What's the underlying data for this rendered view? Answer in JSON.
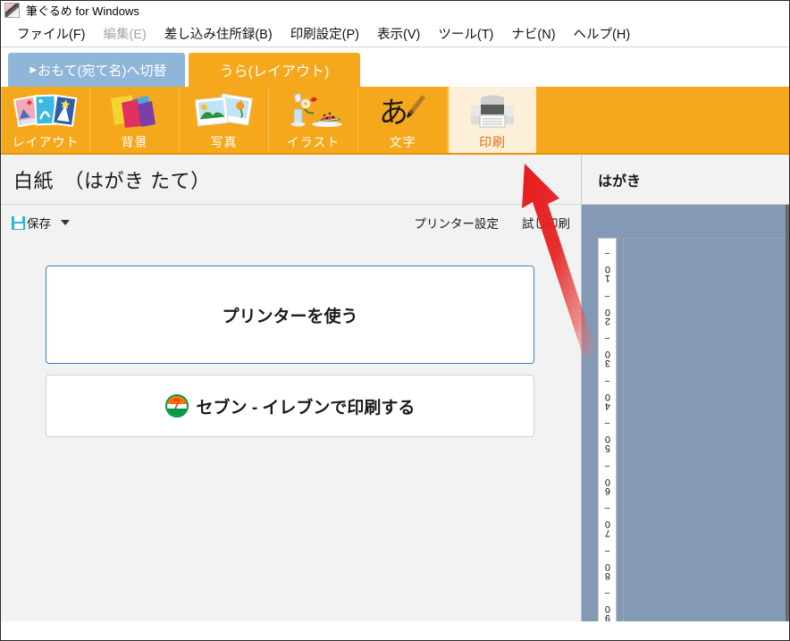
{
  "window": {
    "title": "筆ぐるめ for Windows",
    "app_icon": "brush-icon"
  },
  "menubar": {
    "items": [
      {
        "label": "ファイル(F)",
        "disabled": false
      },
      {
        "label": "編集(E)",
        "disabled": true
      },
      {
        "label": "差し込み住所録(B)",
        "disabled": false
      },
      {
        "label": "印刷設定(P)",
        "disabled": false
      },
      {
        "label": "表示(V)",
        "disabled": false
      },
      {
        "label": "ツール(T)",
        "disabled": false
      },
      {
        "label": "ナビ(N)",
        "disabled": false
      },
      {
        "label": "ヘルプ(H)",
        "disabled": false
      }
    ]
  },
  "face_tabs": {
    "omote_label": "おもて(宛て名)へ切替",
    "omote_arrow": "▶",
    "ura_label": "うら(レイアウト)",
    "selected": "ura"
  },
  "icon_toolbar": {
    "items": [
      {
        "label": "レイアウト",
        "icon": "layout-cards-icon",
        "selected": false
      },
      {
        "label": "背景",
        "icon": "background-shapes-icon",
        "selected": false
      },
      {
        "label": "写真",
        "icon": "photos-icon",
        "selected": false
      },
      {
        "label": "イラスト",
        "icon": "illustration-watermelon-icon",
        "selected": false
      },
      {
        "label": "文字",
        "icon": "text-brush-icon",
        "selected": false
      },
      {
        "label": "印刷",
        "icon": "printer-icon",
        "selected": true
      }
    ]
  },
  "document": {
    "title": "白紙　（はがき たて）"
  },
  "action_bar": {
    "save_label": "保存",
    "save_icon": "floppy-disk-icon",
    "dropdown_icon": "caret-down-icon",
    "printer_settings_label": "プリンター設定",
    "test_print_label": "試し印刷"
  },
  "choices": {
    "use_printer_label": "プリンターを使う",
    "seven_eleven_label": "セブン - イレブンで印刷する",
    "seven_eleven_icon": "seven-eleven-logo",
    "seven_eleven_digit": "7"
  },
  "preview": {
    "title": "はがき",
    "ruler_numbers": [
      "10",
      "20",
      "30",
      "40",
      "50",
      "60",
      "70",
      "80",
      "90"
    ],
    "canvas_color": "#8399b4"
  },
  "annotation": {
    "arrow_color": "#e81b1b",
    "arrow_target": "印刷",
    "arrow_name": "red-pointer-arrow"
  }
}
